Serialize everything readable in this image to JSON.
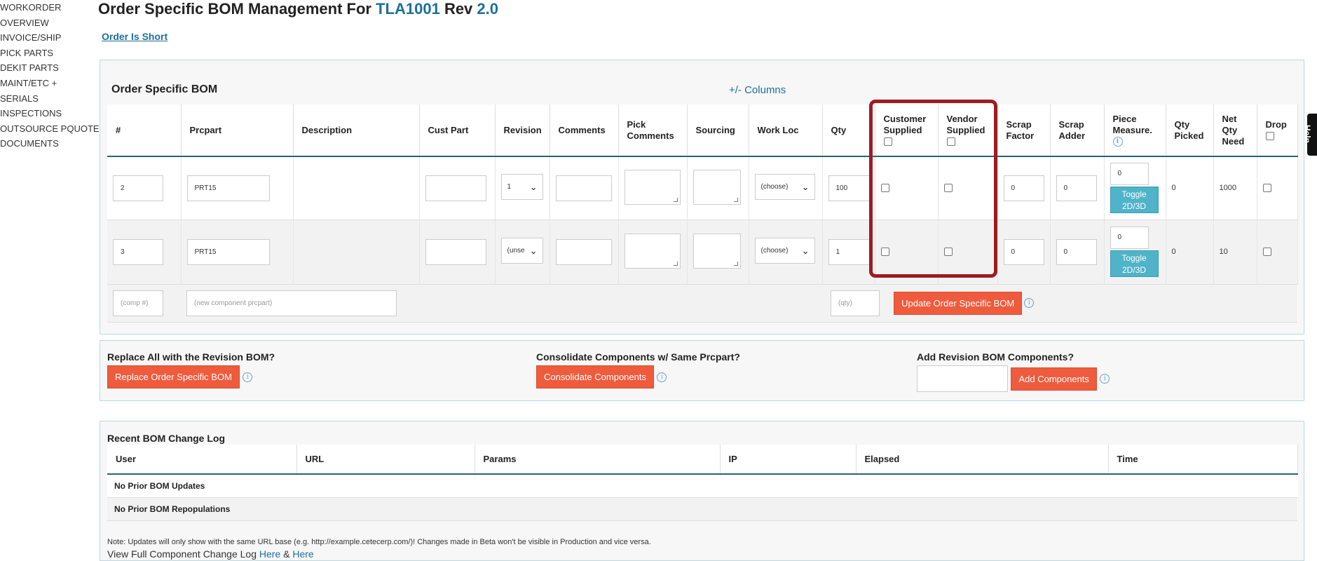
{
  "nav": {
    "items": [
      "WORKORDER",
      "OVERVIEW",
      "INVOICE/SHIP",
      "PICK PARTS",
      "DEKIT PARTS",
      "MAINT/ETC +",
      "SERIALS",
      "INSPECTIONS",
      "OUTSOURCE PQUOTE",
      "DOCUMENTS"
    ]
  },
  "header": {
    "title_prefix": "Order Specific BOM Management For",
    "part": "TLA1001",
    "rev_label": "Rev",
    "rev": "2.0",
    "short_link": "Order Is Short",
    "help_tab": "Help"
  },
  "bom": {
    "title": "Order Specific BOM",
    "columns_link": "+/- Columns",
    "headers": {
      "num": "#",
      "prcpart": "Prcpart",
      "description": "Description",
      "cust_part": "Cust Part",
      "revision": "Revision",
      "comments": "Comments",
      "pick_comments": "Pick Comments",
      "sourcing": "Sourcing",
      "work_loc": "Work Loc",
      "qty": "Qty",
      "customer_supplied": "Customer Supplied",
      "vendor_supplied": "Vendor Supplied",
      "scrap_factor": "Scrap Factor",
      "scrap_adder": "Scrap Adder",
      "piece_measure": "Piece Measure.",
      "qty_picked": "Qty Picked",
      "net_qty_need": "Net Qty Need",
      "drop": "Drop"
    },
    "rows": [
      {
        "num": "2",
        "prcpart": "PRT15",
        "revision": "1",
        "work_loc": "(choose)",
        "qty": "100",
        "scrap_factor": "0",
        "scrap_adder": "0",
        "piece_measure": "0",
        "toggle": "Toggle 2D/3D",
        "qty_picked": "0",
        "net_qty_need": "1000"
      },
      {
        "num": "3",
        "prcpart": "PRT15",
        "revision": "(unse",
        "work_loc": "(choose)",
        "qty": "1",
        "scrap_factor": "0",
        "scrap_adder": "0",
        "piece_measure": "0",
        "toggle": "Toggle 2D/3D",
        "qty_picked": "0",
        "net_qty_need": "10"
      }
    ],
    "new_row": {
      "comp_placeholder": "(comp #)",
      "prcpart_placeholder": "(new component prcpart)",
      "qty_placeholder": "(qty)",
      "update_button": "Update Order Specific BOM"
    }
  },
  "actions": {
    "replace": {
      "title": "Replace All with the Revision BOM?",
      "button": "Replace Order Specific BOM"
    },
    "consolidate": {
      "title": "Consolidate Components w/ Same Prcpart?",
      "button": "Consolidate Components"
    },
    "add": {
      "title": "Add Revision BOM Components?",
      "button": "Add Components"
    }
  },
  "log": {
    "title": "Recent BOM Change Log",
    "headers": [
      "User",
      "URL",
      "Params",
      "IP",
      "Elapsed",
      "Time"
    ],
    "rows": [
      "No Prior BOM Updates",
      "No Prior BOM Repopulations"
    ],
    "note": "Note: Updates will only show with the same URL base (e.g. http://example.cetecerp.com/)! Changes made in Beta won't be visible in Production and vice versa.",
    "full_log_text": "View Full Component Change Log",
    "here1": "Here",
    "amp": "&",
    "here2": "Here"
  },
  "colors": {
    "accent": "#1d6f9c",
    "danger_button": "#ef5b3d",
    "toggle_button": "#4fb3c9",
    "highlight": "#9e1b22"
  }
}
